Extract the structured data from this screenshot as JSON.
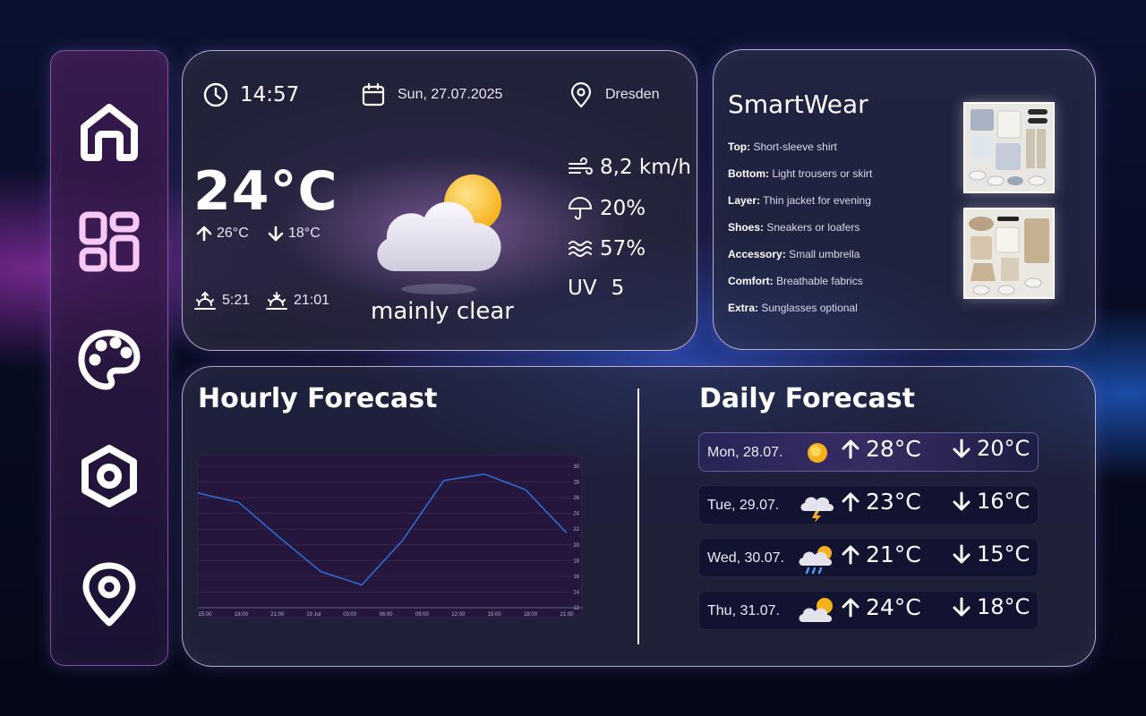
{
  "sidebar": {
    "items": [
      {
        "icon": "home-icon"
      },
      {
        "icon": "dashboard-grid-icon",
        "active_color": "#f8c8f5"
      },
      {
        "icon": "palette-icon"
      },
      {
        "icon": "settings-hexagon-icon"
      },
      {
        "icon": "location-pin-icon"
      }
    ]
  },
  "current": {
    "time": "14:57",
    "date": "Sun, 27.07.2025",
    "location": "Dresden",
    "temperature": "24°C",
    "max_temp": "26°C",
    "min_temp": "18°C",
    "sunrise": "5:21",
    "sunset": "21:01",
    "condition": "mainly clear",
    "condition_icon": "partly-cloudy-icon",
    "wind": "8,2 km/h",
    "precipitation": "20%",
    "humidity": "57%",
    "uv_label": "UV",
    "uv_value": "5"
  },
  "smartwear": {
    "title": "SmartWear",
    "items": [
      {
        "label": "Top:",
        "value": "Short-sleeve shirt"
      },
      {
        "label": "Bottom:",
        "value": "Light trousers or skirt"
      },
      {
        "label": "Layer:",
        "value": "Thin jacket for evening"
      },
      {
        "label": "Shoes:",
        "value": "Sneakers or loafers"
      },
      {
        "label": "Accessory:",
        "value": "Small umbrella"
      },
      {
        "label": "Comfort:",
        "value": "Breathable fabrics"
      },
      {
        "label": "Extra:",
        "value": "Sunglasses optional"
      }
    ]
  },
  "hourly": {
    "title": "Hourly Forecast"
  },
  "chart_data": {
    "type": "line",
    "x": [
      "15:00",
      "18:00",
      "21:00",
      "19 Jul",
      "03:00",
      "06:00",
      "09:00",
      "12:00",
      "15:00",
      "18:00",
      "21:00"
    ],
    "values": [
      26.6,
      25.4,
      20.9,
      16.6,
      14.9,
      20.6,
      28.2,
      29.0,
      27.0,
      21.5
    ],
    "ylim": [
      12,
      30
    ],
    "yticks": [
      "12",
      "14",
      "16",
      "18",
      "20",
      "22",
      "24",
      "26",
      "28",
      "30"
    ],
    "line_color": "#2f6fd6",
    "background": "#25163d"
  },
  "daily": {
    "title": "Daily Forecast",
    "days": [
      {
        "name": "Mon, 28.07.",
        "icon": "sun-icon",
        "high": "28°C",
        "low": "20°C"
      },
      {
        "name": "Tue, 29.07.",
        "icon": "thunderstorm-icon",
        "high": "23°C",
        "low": "16°C"
      },
      {
        "name": "Wed, 30.07.",
        "icon": "rain-sun-icon",
        "high": "21°C",
        "low": "15°C"
      },
      {
        "name": "Thu, 31.07.",
        "icon": "partly-cloudy-icon",
        "high": "24°C",
        "low": "18°C"
      }
    ]
  }
}
